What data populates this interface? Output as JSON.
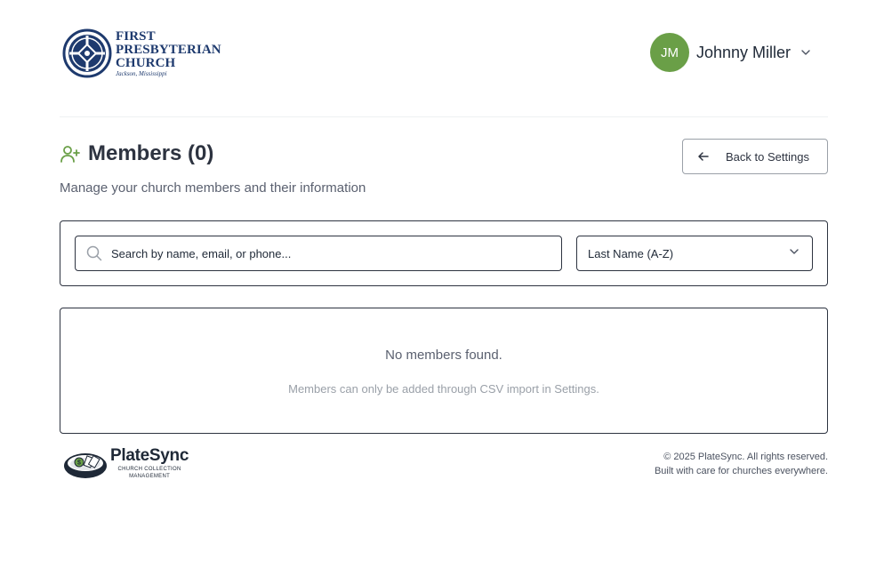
{
  "header": {
    "church_logo": {
      "line1": "FIRST",
      "line2": "PRESBYTERIAN",
      "line3": "CHURCH",
      "line4": "Jackson, Mississippi"
    },
    "user": {
      "initials": "JM",
      "name": "Johnny Miller",
      "avatar_color": "#6a9f47"
    }
  },
  "page": {
    "title": "Members (0)",
    "title_icon": "user-plus-icon",
    "subtitle": "Manage your church members and their information",
    "back_button_label": "Back to Settings"
  },
  "filters": {
    "search_placeholder": "Search by name, email, or phone...",
    "sort_selected": "Last Name (A-Z)"
  },
  "results": {
    "empty_title": "No members found.",
    "empty_subtitle": "Members can only be added through CSV import in Settings."
  },
  "footer": {
    "brand_name": "PlateSync",
    "brand_tag_line1": "CHURCH COLLECTION",
    "brand_tag_line2": "MANAGEMENT",
    "copyright": "© 2025 PlateSync. All rights reserved.",
    "tagline": "Built with care for churches everywhere."
  },
  "colors": {
    "accent_green": "#6a9f47",
    "church_navy": "#1e3a6e",
    "border_dark": "#2d3340"
  }
}
